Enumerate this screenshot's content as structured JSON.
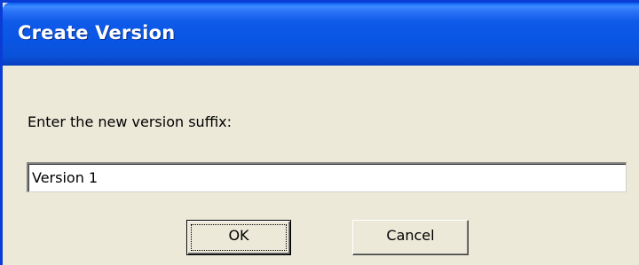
{
  "window": {
    "title": "Create Version"
  },
  "dialog": {
    "prompt": "Enter the new version suffix:",
    "suffix_value": "Version 1"
  },
  "buttons": {
    "ok_label": "OK",
    "cancel_label": "Cancel"
  },
  "colors": {
    "titlebar": "#0a52d8",
    "dialog_background": "#ece9d8"
  }
}
